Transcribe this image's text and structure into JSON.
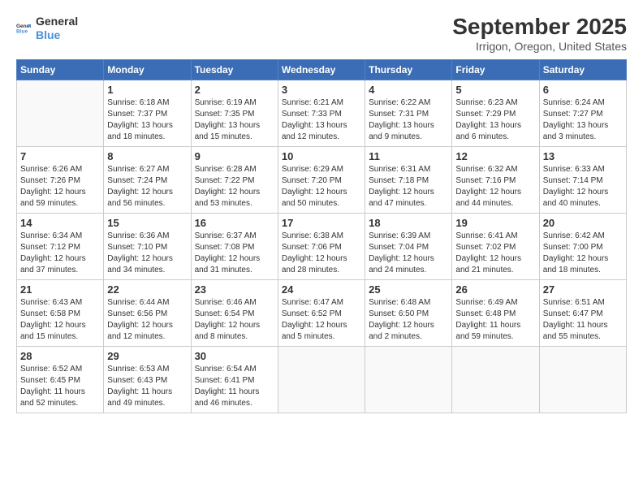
{
  "header": {
    "logo_general": "General",
    "logo_blue": "Blue",
    "title": "September 2025",
    "subtitle": "Irrigon, Oregon, United States"
  },
  "days_of_week": [
    "Sunday",
    "Monday",
    "Tuesday",
    "Wednesday",
    "Thursday",
    "Friday",
    "Saturday"
  ],
  "weeks": [
    [
      {
        "date": "",
        "info": ""
      },
      {
        "date": "1",
        "info": "Sunrise: 6:18 AM\nSunset: 7:37 PM\nDaylight: 13 hours\nand 18 minutes."
      },
      {
        "date": "2",
        "info": "Sunrise: 6:19 AM\nSunset: 7:35 PM\nDaylight: 13 hours\nand 15 minutes."
      },
      {
        "date": "3",
        "info": "Sunrise: 6:21 AM\nSunset: 7:33 PM\nDaylight: 13 hours\nand 12 minutes."
      },
      {
        "date": "4",
        "info": "Sunrise: 6:22 AM\nSunset: 7:31 PM\nDaylight: 13 hours\nand 9 minutes."
      },
      {
        "date": "5",
        "info": "Sunrise: 6:23 AM\nSunset: 7:29 PM\nDaylight: 13 hours\nand 6 minutes."
      },
      {
        "date": "6",
        "info": "Sunrise: 6:24 AM\nSunset: 7:27 PM\nDaylight: 13 hours\nand 3 minutes."
      }
    ],
    [
      {
        "date": "7",
        "info": "Sunrise: 6:26 AM\nSunset: 7:26 PM\nDaylight: 12 hours\nand 59 minutes."
      },
      {
        "date": "8",
        "info": "Sunrise: 6:27 AM\nSunset: 7:24 PM\nDaylight: 12 hours\nand 56 minutes."
      },
      {
        "date": "9",
        "info": "Sunrise: 6:28 AM\nSunset: 7:22 PM\nDaylight: 12 hours\nand 53 minutes."
      },
      {
        "date": "10",
        "info": "Sunrise: 6:29 AM\nSunset: 7:20 PM\nDaylight: 12 hours\nand 50 minutes."
      },
      {
        "date": "11",
        "info": "Sunrise: 6:31 AM\nSunset: 7:18 PM\nDaylight: 12 hours\nand 47 minutes."
      },
      {
        "date": "12",
        "info": "Sunrise: 6:32 AM\nSunset: 7:16 PM\nDaylight: 12 hours\nand 44 minutes."
      },
      {
        "date": "13",
        "info": "Sunrise: 6:33 AM\nSunset: 7:14 PM\nDaylight: 12 hours\nand 40 minutes."
      }
    ],
    [
      {
        "date": "14",
        "info": "Sunrise: 6:34 AM\nSunset: 7:12 PM\nDaylight: 12 hours\nand 37 minutes."
      },
      {
        "date": "15",
        "info": "Sunrise: 6:36 AM\nSunset: 7:10 PM\nDaylight: 12 hours\nand 34 minutes."
      },
      {
        "date": "16",
        "info": "Sunrise: 6:37 AM\nSunset: 7:08 PM\nDaylight: 12 hours\nand 31 minutes."
      },
      {
        "date": "17",
        "info": "Sunrise: 6:38 AM\nSunset: 7:06 PM\nDaylight: 12 hours\nand 28 minutes."
      },
      {
        "date": "18",
        "info": "Sunrise: 6:39 AM\nSunset: 7:04 PM\nDaylight: 12 hours\nand 24 minutes."
      },
      {
        "date": "19",
        "info": "Sunrise: 6:41 AM\nSunset: 7:02 PM\nDaylight: 12 hours\nand 21 minutes."
      },
      {
        "date": "20",
        "info": "Sunrise: 6:42 AM\nSunset: 7:00 PM\nDaylight: 12 hours\nand 18 minutes."
      }
    ],
    [
      {
        "date": "21",
        "info": "Sunrise: 6:43 AM\nSunset: 6:58 PM\nDaylight: 12 hours\nand 15 minutes."
      },
      {
        "date": "22",
        "info": "Sunrise: 6:44 AM\nSunset: 6:56 PM\nDaylight: 12 hours\nand 12 minutes."
      },
      {
        "date": "23",
        "info": "Sunrise: 6:46 AM\nSunset: 6:54 PM\nDaylight: 12 hours\nand 8 minutes."
      },
      {
        "date": "24",
        "info": "Sunrise: 6:47 AM\nSunset: 6:52 PM\nDaylight: 12 hours\nand 5 minutes."
      },
      {
        "date": "25",
        "info": "Sunrise: 6:48 AM\nSunset: 6:50 PM\nDaylight: 12 hours\nand 2 minutes."
      },
      {
        "date": "26",
        "info": "Sunrise: 6:49 AM\nSunset: 6:48 PM\nDaylight: 11 hours\nand 59 minutes."
      },
      {
        "date": "27",
        "info": "Sunrise: 6:51 AM\nSunset: 6:47 PM\nDaylight: 11 hours\nand 55 minutes."
      }
    ],
    [
      {
        "date": "28",
        "info": "Sunrise: 6:52 AM\nSunset: 6:45 PM\nDaylight: 11 hours\nand 52 minutes."
      },
      {
        "date": "29",
        "info": "Sunrise: 6:53 AM\nSunset: 6:43 PM\nDaylight: 11 hours\nand 49 minutes."
      },
      {
        "date": "30",
        "info": "Sunrise: 6:54 AM\nSunset: 6:41 PM\nDaylight: 11 hours\nand 46 minutes."
      },
      {
        "date": "",
        "info": ""
      },
      {
        "date": "",
        "info": ""
      },
      {
        "date": "",
        "info": ""
      },
      {
        "date": "",
        "info": ""
      }
    ]
  ]
}
